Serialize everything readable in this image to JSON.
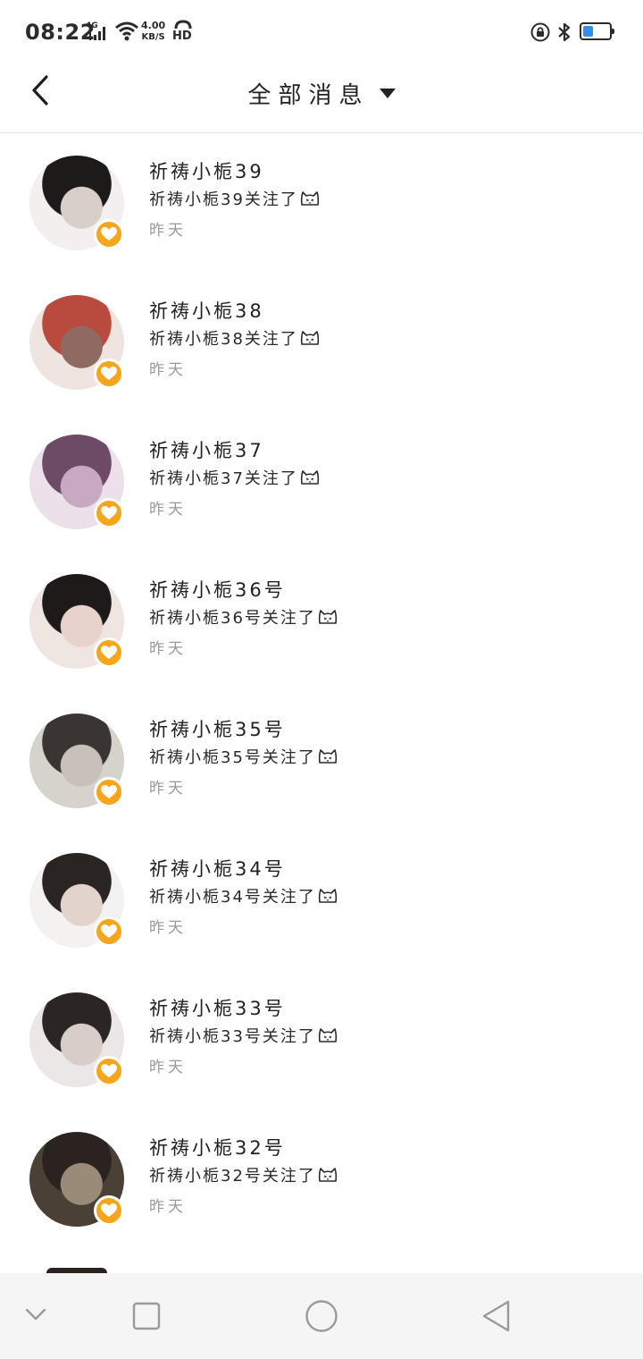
{
  "status_bar": {
    "time": "08:22",
    "network_label": "4G",
    "speed_value": "4.00",
    "speed_unit": "KB/S",
    "hd_label": "HD",
    "battery_level": 0.4
  },
  "header": {
    "title": "全部消息"
  },
  "notifications": [
    {
      "name": "祈祷小栀39",
      "message": "祈祷小栀39关注了",
      "time": "昨天",
      "avatar_colors": [
        "#f2efee",
        "#1d1a1a",
        "#d9cfc9"
      ]
    },
    {
      "name": "祈祷小栀38",
      "message": "祈祷小栀38关注了",
      "time": "昨天",
      "avatar_colors": [
        "#efe4e0",
        "#b84a3e",
        "#8e6a63"
      ]
    },
    {
      "name": "祈祷小栀37",
      "message": "祈祷小栀37关注了",
      "time": "昨天",
      "avatar_colors": [
        "#ece0ea",
        "#6d4a66",
        "#c7a9c2"
      ]
    },
    {
      "name": "祈祷小栀36号",
      "message": "祈祷小栀36号关注了",
      "time": "昨天",
      "avatar_colors": [
        "#efe6e2",
        "#1e1a1a",
        "#e8d3cc"
      ]
    },
    {
      "name": "祈祷小栀35号",
      "message": "祈祷小栀35号关注了",
      "time": "昨天",
      "avatar_colors": [
        "#d6d2cc",
        "#3a3533",
        "#c9c0b9"
      ]
    },
    {
      "name": "祈祷小栀34号",
      "message": "祈祷小栀34号关注了",
      "time": "昨天",
      "avatar_colors": [
        "#f4f2f0",
        "#2a2422",
        "#e2d3cd"
      ]
    },
    {
      "name": "祈祷小栀33号",
      "message": "祈祷小栀33号关注了",
      "time": "昨天",
      "avatar_colors": [
        "#eae7e6",
        "#2b2624",
        "#d8cdc8"
      ]
    },
    {
      "name": "祈祷小栀32号",
      "message": "祈祷小栀32号关注了",
      "time": "昨天",
      "avatar_colors": [
        "#4a4036",
        "#2a2320",
        "#9a8a78"
      ]
    }
  ],
  "nav_bar": {
    "icons": [
      "chevron-down-icon",
      "square-icon",
      "circle-icon",
      "triangle-back-icon"
    ]
  },
  "colors": {
    "badge": "#f7a51c",
    "time_text": "#999999",
    "battery_fill": "#2f8ff0"
  }
}
